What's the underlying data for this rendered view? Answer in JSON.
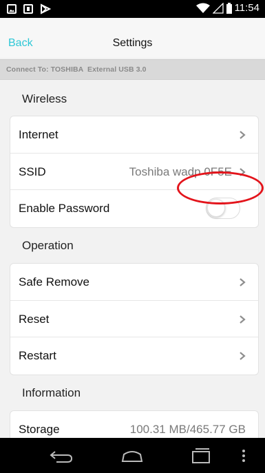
{
  "status_bar": {
    "time": "11:54",
    "left_icons": [
      "image-icon",
      "download-icon",
      "play-store-icon"
    ],
    "right_icons": [
      "wifi-icon",
      "signal-icon",
      "battery-icon"
    ]
  },
  "header": {
    "back_label": "Back",
    "title": "Settings"
  },
  "connect_bar": {
    "text": "Connect To: TOSHIBA  External USB 3.0"
  },
  "sections": {
    "wireless": {
      "title": "Wireless",
      "rows": [
        {
          "label": "Internet",
          "value": ""
        },
        {
          "label": "SSID",
          "value": "Toshiba wadp 0F5E"
        },
        {
          "label": "Enable Password",
          "toggle": false
        }
      ]
    },
    "operation": {
      "title": "Operation",
      "rows": [
        {
          "label": "Safe Remove"
        },
        {
          "label": "Reset"
        },
        {
          "label": "Restart"
        }
      ]
    },
    "information": {
      "title": "Information",
      "rows": [
        {
          "label": "Storage",
          "value": "100.31 MB/465.77 GB"
        }
      ]
    }
  },
  "nav_bar": {
    "icons": [
      "back-icon",
      "home-icon",
      "recents-icon",
      "overflow-menu-icon"
    ]
  },
  "colors": {
    "accent": "#2ec7d6",
    "annotation": "#e3141b"
  }
}
